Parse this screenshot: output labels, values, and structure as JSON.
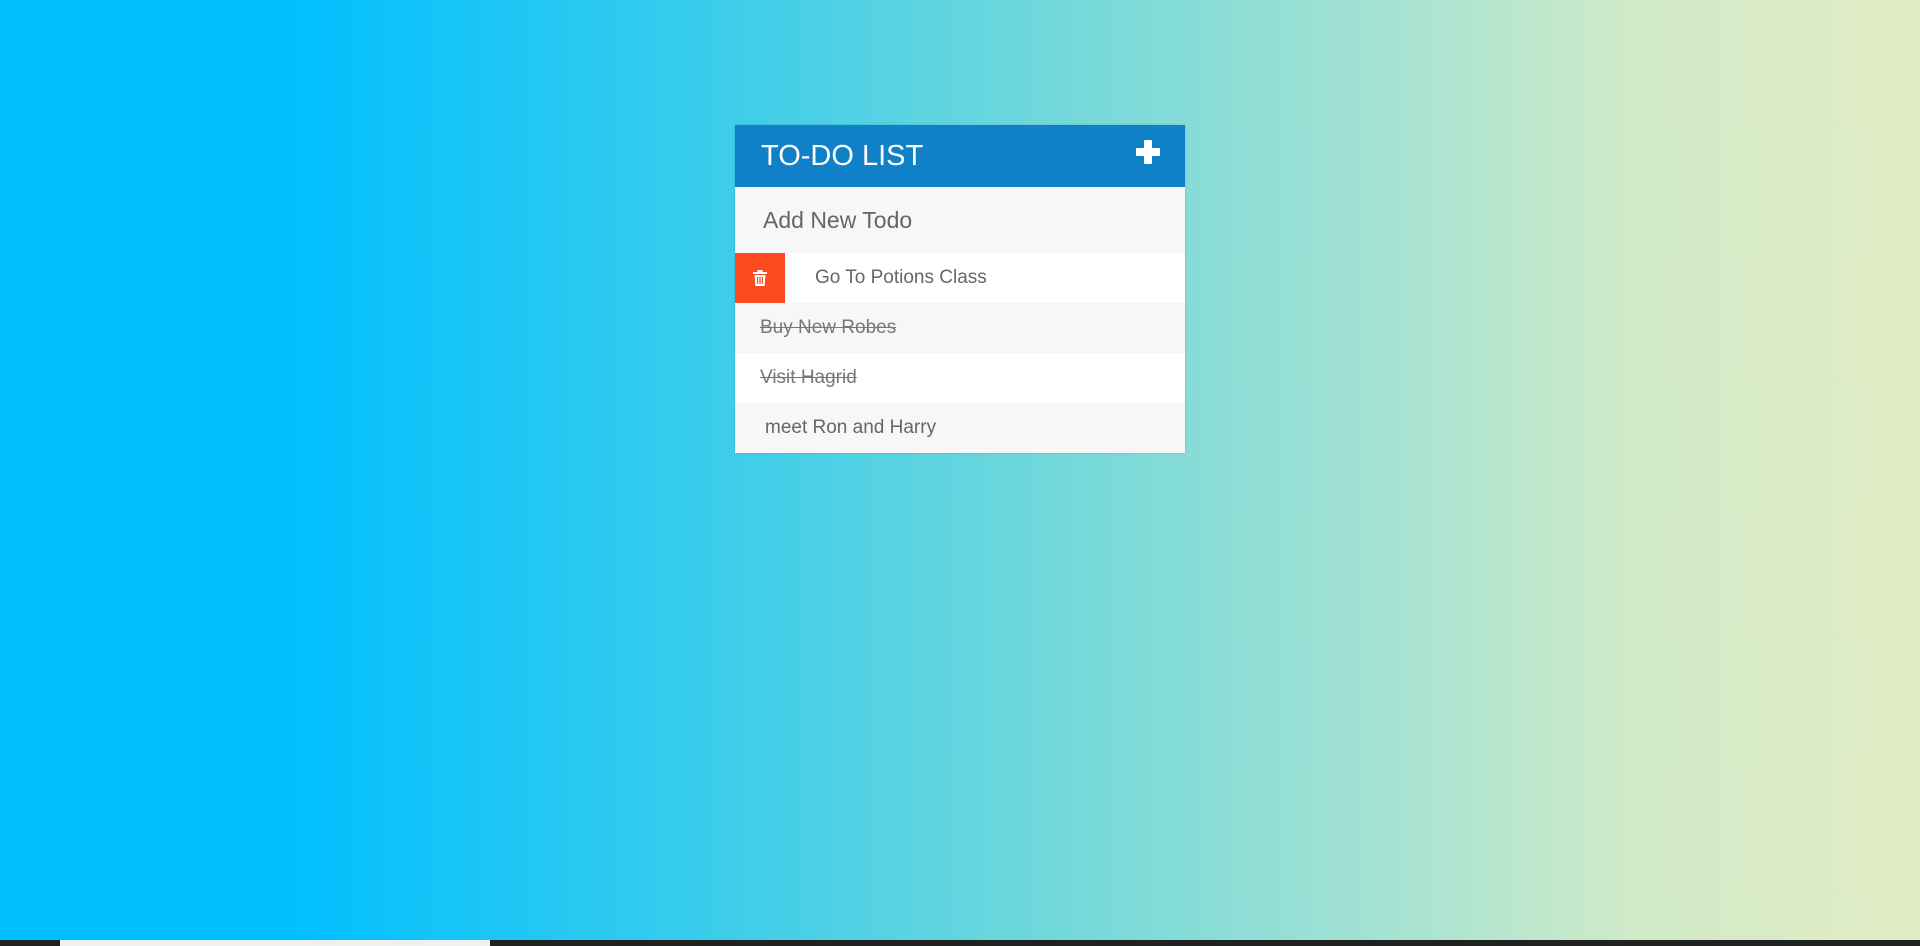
{
  "header": {
    "title": "TO-DO LIST",
    "add_icon": "plus-icon"
  },
  "input": {
    "placeholder": "Add New Todo",
    "value": ""
  },
  "todos": [
    {
      "text": "Go To Potions Class",
      "completed": false,
      "delete_visible": true
    },
    {
      "text": "Buy New Robes",
      "completed": true,
      "delete_visible": false
    },
    {
      "text": "Visit Hagrid",
      "completed": true,
      "delete_visible": false
    },
    {
      "text": "meet Ron and Harry",
      "completed": false,
      "delete_visible": false
    }
  ],
  "colors": {
    "header_bg": "#1081c8",
    "delete_bg": "#fa4a1e",
    "text": "#666666"
  },
  "delete_icon": "trash-icon"
}
